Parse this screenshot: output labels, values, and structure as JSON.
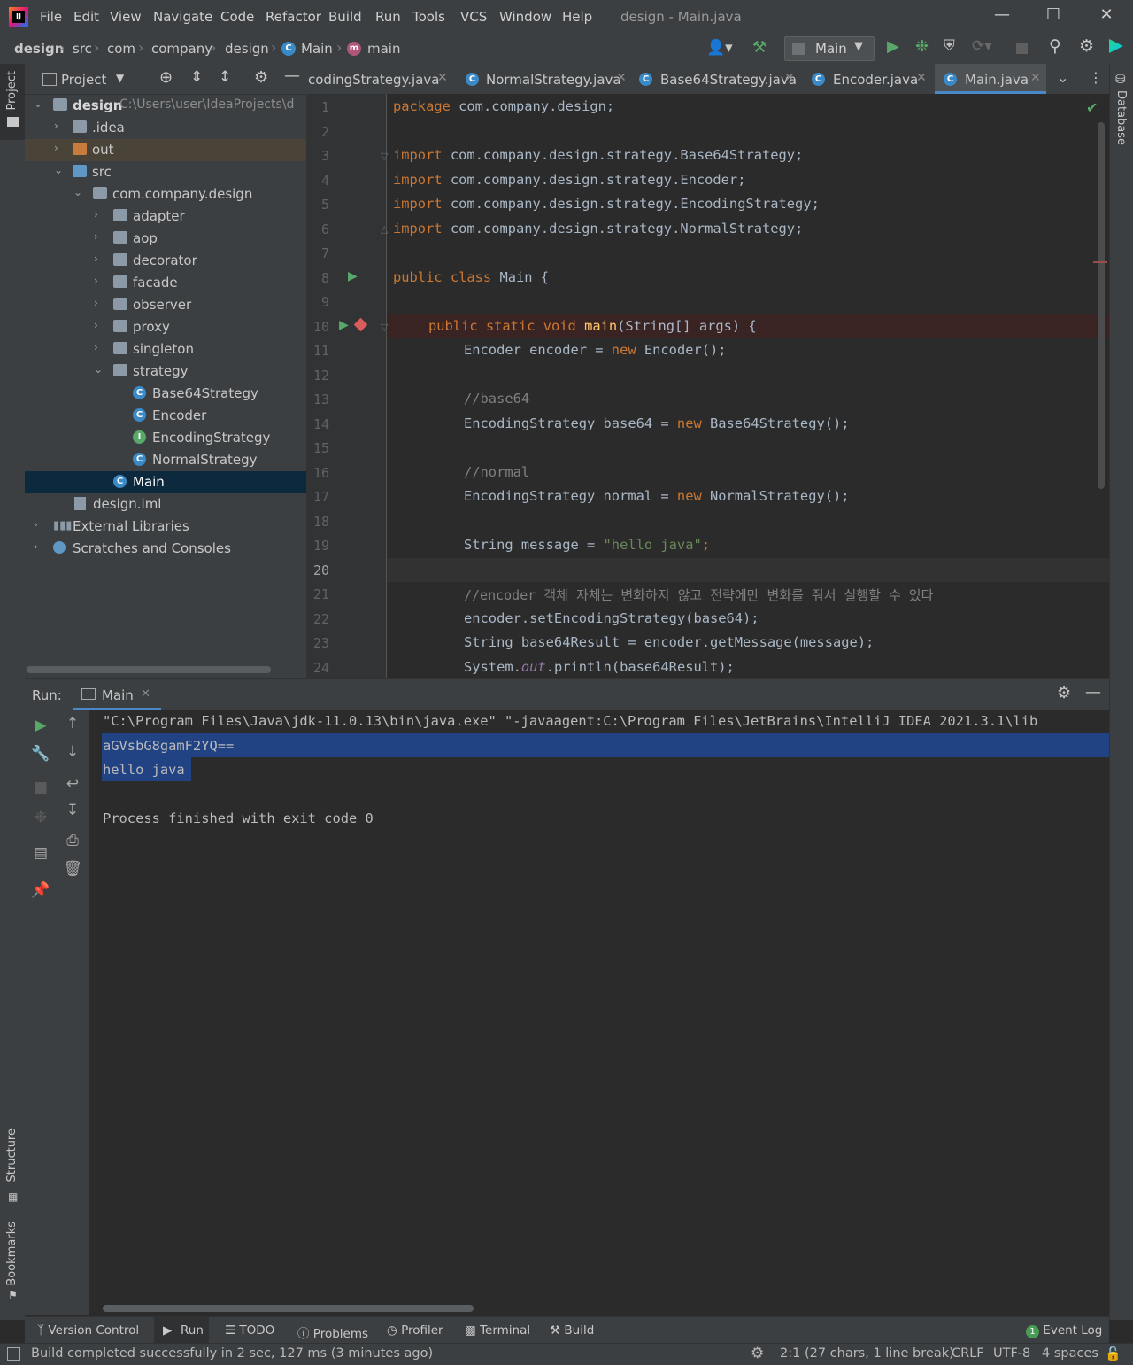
{
  "menu": {
    "items": [
      "File",
      "Edit",
      "View",
      "Navigate",
      "Code",
      "Refactor",
      "Build",
      "Run",
      "Tools",
      "VCS",
      "Window",
      "Help"
    ],
    "window_title": "design - Main.java"
  },
  "breadcrumbs": [
    "design",
    "src",
    "com",
    "company",
    "design",
    "Main",
    "main"
  ],
  "toolbar": {
    "run_config": "Main"
  },
  "project": {
    "header": "Project",
    "root_label": "design",
    "root_path": "C:\\Users\\user\\IdeaProjects\\d",
    "items": [
      {
        "label": ".idea"
      },
      {
        "label": "out"
      },
      {
        "label": "src"
      },
      {
        "label": "com.company.design"
      },
      {
        "label": "adapter"
      },
      {
        "label": "aop"
      },
      {
        "label": "decorator"
      },
      {
        "label": "facade"
      },
      {
        "label": "observer"
      },
      {
        "label": "proxy"
      },
      {
        "label": "singleton"
      },
      {
        "label": "strategy"
      },
      {
        "label": "Base64Strategy"
      },
      {
        "label": "Encoder"
      },
      {
        "label": "EncodingStrategy"
      },
      {
        "label": "NormalStrategy"
      },
      {
        "label": "Main"
      },
      {
        "label": "design.iml"
      },
      {
        "label": "External Libraries"
      },
      {
        "label": "Scratches and Consoles"
      }
    ]
  },
  "editor": {
    "tabs": [
      "codingStrategy.java",
      "NormalStrategy.java",
      "Base64Strategy.java",
      "Encoder.java",
      "Main.java"
    ],
    "active_tab": "Main.java",
    "line_numbers": [
      "1",
      "2",
      "3",
      "4",
      "5",
      "6",
      "7",
      "8",
      "9",
      "10",
      "11",
      "12",
      "13",
      "14",
      "15",
      "16",
      "17",
      "18",
      "19",
      "20",
      "21",
      "22",
      "23",
      "24"
    ],
    "code": {
      "l1_kw": "package",
      "l1_rest": " com.company.design;",
      "l3": "com.company.design.strategy.Base64Strategy;",
      "l4": "com.company.design.strategy.Encoder;",
      "l5": "com.company.design.strategy.EncodingStrategy;",
      "l6": "com.company.design.strategy.NormalStrategy;",
      "import_kw": "import",
      "l8_kw": "public class",
      "l8_rest": " Main {",
      "l10_kw": "public static void",
      "l10_fn": "main",
      "l10_rest": "(String[] args) {",
      "l11_a": "Encoder encoder = ",
      "l11_kw": "new",
      "l11_b": " Encoder();",
      "l13": "//base64",
      "l14_a": "EncodingStrategy base64 = ",
      "l14_kw": "new",
      "l14_b": " Base64Strategy();",
      "l16": "//normal",
      "l17_a": "EncodingStrategy normal = ",
      "l17_kw": "new",
      "l17_b": " NormalStrategy();",
      "l19_a": "String message = ",
      "l19_str": "\"hello java\"",
      "l19_b": ";",
      "l21": "//encoder 객체 자체는 변화하지 않고 전략에만 변화를 줘서 실행할 수 있다",
      "l22": "encoder.setEncodingStrategy(base64);",
      "l23": "String base64Result = encoder.getMessage(message);",
      "l24_a": "System.",
      "l24_it": "out",
      "l24_b": ".println(base64Result);"
    }
  },
  "run": {
    "label": "Run:",
    "tab": "Main",
    "console": [
      "\"C:\\Program Files\\Java\\jdk-11.0.13\\bin\\java.exe\" \"-javaagent:C:\\Program Files\\JetBrains\\IntelliJ IDEA 2021.3.1\\lib",
      "aGVsbG8gamF2YQ==",
      "hello java",
      "",
      "Process finished with exit code 0"
    ]
  },
  "side_tabs": {
    "project": "Project",
    "structure": "Structure",
    "bookmarks": "Bookmarks",
    "database": "Database"
  },
  "bottom_tabs": [
    "Version Control",
    "Run",
    "TODO",
    "Problems",
    "Profiler",
    "Terminal",
    "Build"
  ],
  "event_log": {
    "count": "1",
    "label": "Event Log"
  },
  "status": {
    "message": "Build completed successfully in 2 sec, 127 ms (3 minutes ago)",
    "position": "2:1 (27 chars, 1 line break)",
    "line_sep": "CRLF",
    "encoding": "UTF-8",
    "indent": "4 spaces"
  },
  "colors": {
    "accent": "#2f65ca",
    "selection": "#214283",
    "keyword": "#cc7832",
    "string": "#6a8759",
    "comment": "#808080"
  }
}
